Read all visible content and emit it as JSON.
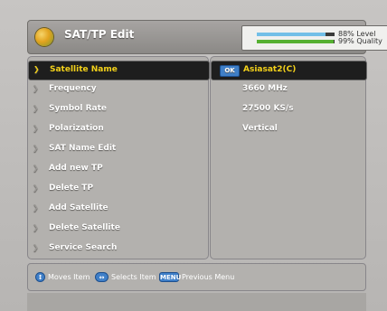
{
  "header": {
    "title": "SAT/TP Edit",
    "level_label": "88% Level",
    "quality_label": "99% Quality",
    "level_value": 88,
    "quality_value": 99
  },
  "menu": {
    "items": [
      {
        "label": "Satellite Name"
      },
      {
        "label": "Frequency"
      },
      {
        "label": "Symbol Rate"
      },
      {
        "label": "Polarization"
      },
      {
        "label": "SAT Name Edit"
      },
      {
        "label": "Add new TP"
      },
      {
        "label": "Delete TP"
      },
      {
        "label": "Add Satellite"
      },
      {
        "label": "Delete Satellite"
      },
      {
        "label": "Service Search"
      }
    ]
  },
  "values": {
    "ok_label": "OK",
    "satellite_name": "Asiasat2(C)",
    "frequency": "3660 MHz",
    "symbol_rate": "27500 KS/s",
    "polarization": "Vertical"
  },
  "help": {
    "moves_label": "Moves Item",
    "selects_label": "Selects Item",
    "menu_icon_label": "MENU",
    "previous_label": "Previous Menu"
  },
  "colors": {
    "highlight_text": "#f3d11a",
    "level_bar": "#72bfe7",
    "quality_bar": "#56b032",
    "badge_blue": "#3f7fc8"
  }
}
